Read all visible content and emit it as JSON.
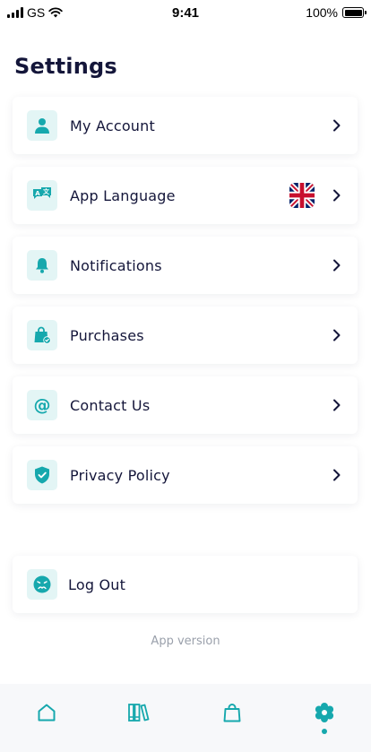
{
  "status_bar": {
    "carrier": "GS",
    "time": "9:41",
    "battery": "100%"
  },
  "page": {
    "title": "Settings"
  },
  "menu": {
    "items": [
      {
        "label": "My Account",
        "icon": "user-icon"
      },
      {
        "label": "App Language",
        "icon": "translate-icon",
        "flag": "uk-flag-icon"
      },
      {
        "label": "Notifications",
        "icon": "bell-icon"
      },
      {
        "label": "Purchases",
        "icon": "shopping-bag-check-icon"
      },
      {
        "label": "Contact Us",
        "icon": "at-sign-icon"
      },
      {
        "label": "Privacy Policy",
        "icon": "shield-check-icon"
      }
    ]
  },
  "logout": {
    "label": "Log Out",
    "icon": "sad-face-icon"
  },
  "footer": {
    "app_version": "App version"
  },
  "bottom_nav": {
    "items": [
      {
        "icon": "home-icon",
        "active": false
      },
      {
        "icon": "library-icon",
        "active": false
      },
      {
        "icon": "bag-icon",
        "active": false
      },
      {
        "icon": "settings-gear-icon",
        "active": true
      }
    ]
  },
  "colors": {
    "accent": "#16a8ad",
    "icon_bg": "#e3f5f5",
    "title": "#14163a",
    "muted": "#9aa0ab",
    "nav_bg": "#f7f8fa"
  }
}
